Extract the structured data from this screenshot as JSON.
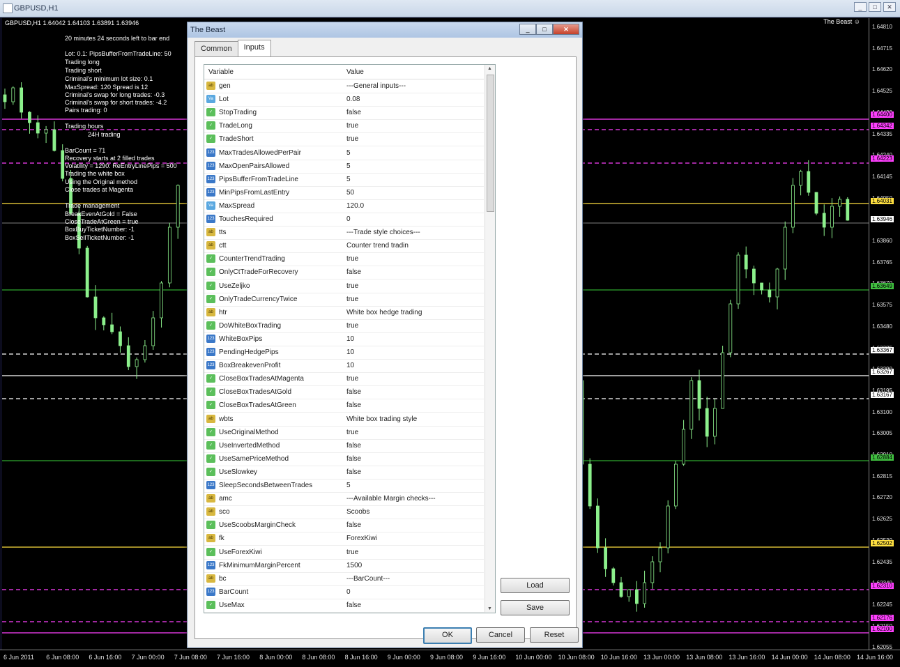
{
  "window": {
    "title": "GBPUSD,H1"
  },
  "chart": {
    "symbol_header": "GBPUSD,H1  1.64042 1.64103 1.63891 1.63946",
    "ea_name": "The Beast ☺",
    "info_lines": [
      "20 minutes 24 seconds left to bar end",
      "Lot: 0.1:  PipsBufferFromTradeLine: 50",
      "Trading long",
      "Trading short",
      "Criminal's minimum lot size: 0.1",
      "MaxSpread: 120  Spread is 12",
      "Criminal's swap for long trades: -0.3",
      "Criminal's swap for short trades: -4.2",
      "Pairs trading: 0",
      "Trading hours",
      "24H trading",
      "BarCount = 71",
      "Recovery starts at 2 filled trades",
      "Volatility = 1290:  ReEntryLinePips = 500",
      "Trading the white box",
      "Using the Original method",
      "Close trades at Magenta",
      "Trade management",
      "BreakEvenAtGold = False",
      "CloseTradeAtGreen = true",
      "BoxBuyTicketNumber: -1",
      "BoxSellTicketNumber: -1"
    ],
    "price_ticks": [
      "1.64810",
      "1.64715",
      "1.64620",
      "1.64525",
      "1.64430",
      "1.64335",
      "1.64240",
      "1.64145",
      "1.64050",
      "1.63960",
      "1.63860",
      "1.63765",
      "1.63670",
      "1.63575",
      "1.63480",
      "1.63385",
      "1.63290",
      "1.63195",
      "1.63100",
      "1.63005",
      "1.62910",
      "1.62815",
      "1.62720",
      "1.62625",
      "1.62530",
      "1.62435",
      "1.62340",
      "1.62245",
      "1.62150",
      "1.62055"
    ],
    "price_badges": [
      {
        "text": "1.64400",
        "color": "#ff40ff"
      },
      {
        "text": "1.64342",
        "color": "#ff40ff"
      },
      {
        "text": "1.64223",
        "color": "#ff40ff"
      },
      {
        "text": "1.64031",
        "color": "#ffe040"
      },
      {
        "text": "1.63946",
        "color": "#ffffff"
      },
      {
        "text": "1.63649",
        "color": "#40c040"
      },
      {
        "text": "1.63367",
        "color": "#ffffff"
      },
      {
        "text": "1.63267",
        "color": "#ffffff"
      },
      {
        "text": "1.63167",
        "color": "#ffffff"
      },
      {
        "text": "1.62884",
        "color": "#40c040"
      },
      {
        "text": "1.62502",
        "color": "#ffe040"
      },
      {
        "text": "1.62310",
        "color": "#ff40ff"
      },
      {
        "text": "1.62176",
        "color": "#ff40ff"
      },
      {
        "text": "1.62100",
        "color": "#ff40ff"
      }
    ],
    "time_ticks": [
      "6 Jun 2011",
      "6 Jun 08:00",
      "6 Jun 16:00",
      "7 Jun 00:00",
      "7 Jun 08:00",
      "7 Jun 16:00",
      "8 Jun 00:00",
      "8 Jun 08:00",
      "8 Jun 16:00",
      "9 Jun 00:00",
      "9 Jun 08:00",
      "9 Jun 16:00",
      "10 Jun 00:00",
      "10 Jun 08:00",
      "10 Jun 16:00",
      "13 Jun 00:00",
      "13 Jun 08:00",
      "13 Jun 16:00",
      "14 Jun 00:00",
      "14 Jun 08:00",
      "14 Jun 16:00"
    ],
    "colors": {
      "magenta": "#ff40ff",
      "gold": "#ffe040",
      "green": "#2fa82f",
      "white": "#ffffff",
      "candle": "#8cf08c"
    }
  },
  "dialog": {
    "title": "The Beast",
    "tabs": [
      "Common",
      "Inputs"
    ],
    "active_tab": "Inputs",
    "columns": {
      "variable": "Variable",
      "value": "Value"
    },
    "rows": [
      {
        "t": "ab",
        "n": "gen",
        "v": "---General inputs---"
      },
      {
        "t": "va",
        "n": "Lot",
        "v": "0.08"
      },
      {
        "t": "bo",
        "n": "StopTrading",
        "v": "false"
      },
      {
        "t": "bo",
        "n": "TradeLong",
        "v": "true"
      },
      {
        "t": "bo",
        "n": "TradeShort",
        "v": "true"
      },
      {
        "t": "n123",
        "n": "MaxTradesAllowedPerPair",
        "v": "5"
      },
      {
        "t": "n123",
        "n": "MaxOpenPairsAllowed",
        "v": "5"
      },
      {
        "t": "n123",
        "n": "PipsBufferFromTradeLine",
        "v": "5"
      },
      {
        "t": "n123",
        "n": "MinPipsFromLastEntry",
        "v": "50"
      },
      {
        "t": "va",
        "n": "MaxSpread",
        "v": "120.0"
      },
      {
        "t": "n123",
        "n": "TouchesRequired",
        "v": "0"
      },
      {
        "t": "ab",
        "n": "tts",
        "v": "---Trade style choices---"
      },
      {
        "t": "ab",
        "n": "ctt",
        "v": "Counter trend tradin"
      },
      {
        "t": "bo",
        "n": "CounterTrendTrading",
        "v": "true"
      },
      {
        "t": "bo",
        "n": "OnlyCtTradeForRecovery",
        "v": "false"
      },
      {
        "t": "bo",
        "n": "UseZeljko",
        "v": "true"
      },
      {
        "t": "bo",
        "n": "OnlyTradeCurrencyTwice",
        "v": "true"
      },
      {
        "t": "ab",
        "n": "htr",
        "v": "White box hedge trading"
      },
      {
        "t": "bo",
        "n": "DoWhiteBoxTrading",
        "v": "true"
      },
      {
        "t": "n123",
        "n": "WhiteBoxPips",
        "v": "10"
      },
      {
        "t": "n123",
        "n": "PendingHedgePips",
        "v": "10"
      },
      {
        "t": "n123",
        "n": "BoxBreakevenProfit",
        "v": "10"
      },
      {
        "t": "bo",
        "n": "CloseBoxTradesAtMagenta",
        "v": "true"
      },
      {
        "t": "bo",
        "n": "CloseBoxTradesAtGold",
        "v": "false"
      },
      {
        "t": "bo",
        "n": "CloseBoxTradesAtGreen",
        "v": "false"
      },
      {
        "t": "ab",
        "n": "wbts",
        "v": "White box trading style"
      },
      {
        "t": "bo",
        "n": "UseOriginalMethod",
        "v": "true"
      },
      {
        "t": "bo",
        "n": "UseInvertedMethod",
        "v": "false"
      },
      {
        "t": "bo",
        "n": "UseSamePriceMethod",
        "v": "false"
      },
      {
        "t": "bo",
        "n": "UseSlowkey",
        "v": "false"
      },
      {
        "t": "n123",
        "n": "SleepSecondsBetweenTrades",
        "v": "5"
      },
      {
        "t": "ab",
        "n": "amc",
        "v": "---Available Margin checks---"
      },
      {
        "t": "ab",
        "n": "sco",
        "v": "Scoobs"
      },
      {
        "t": "bo",
        "n": "UseScoobsMarginCheck",
        "v": "false"
      },
      {
        "t": "ab",
        "n": "fk",
        "v": "ForexKiwi"
      },
      {
        "t": "bo",
        "n": "UseForexKiwi",
        "v": "true"
      },
      {
        "t": "n123",
        "n": "FkMinimumMarginPercent",
        "v": "1500"
      },
      {
        "t": "ab",
        "n": "bc",
        "v": "---BarCount---"
      },
      {
        "t": "n123",
        "n": "BarCount",
        "v": "0"
      },
      {
        "t": "bo",
        "n": "UseMax",
        "v": "false"
      }
    ],
    "icons": {
      "ab": "ab",
      "va": "Va",
      "bo": "✓",
      "n123": "123"
    },
    "buttons": {
      "load": "Load",
      "save": "Save",
      "ok": "OK",
      "cancel": "Cancel",
      "reset": "Reset"
    }
  }
}
